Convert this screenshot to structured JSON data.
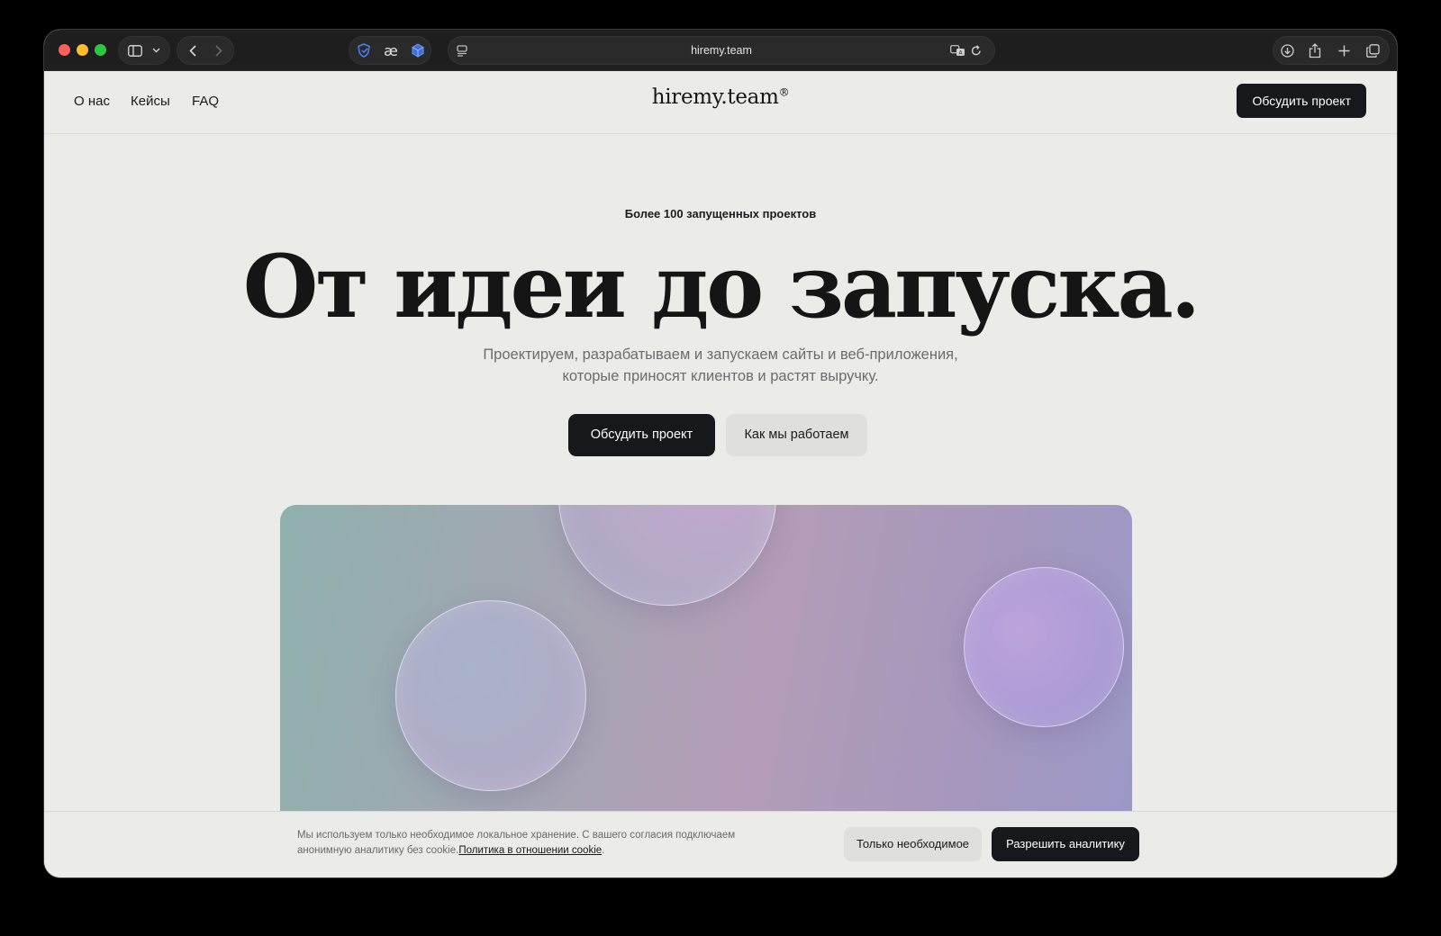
{
  "browser": {
    "url": "hiremy.team"
  },
  "header": {
    "nav": [
      "О нас",
      "Кейсы",
      "FAQ"
    ],
    "logo": "hiremy.team",
    "logo_mark": "®",
    "cta": "Обсудить проект"
  },
  "hero": {
    "eyebrow": "Более 100 запущенных проектов",
    "title": "От идеи до запуска.",
    "subtitle": "Проектируем, разрабатываем и запускаем сайты и веб-приложения, которые приносят клиентов и растят выручку.",
    "primary_button": "Обсудить проект",
    "secondary_button": "Как мы работаем"
  },
  "cookie": {
    "text": "Мы используем только необходимое локальное хранение. С вашего согласия подключаем анонимную аналитику без cookie.",
    "link": "Политика в отношении cookie",
    "link_suffix": ".",
    "essential_button": "Только необходимое",
    "allow_button": "Разрешить аналитику"
  },
  "colors": {
    "accent_dark": "#17181b",
    "page_bg": "#ebebe7",
    "gradient_start": "#8fb0ad",
    "gradient_end": "#9c98c6"
  }
}
